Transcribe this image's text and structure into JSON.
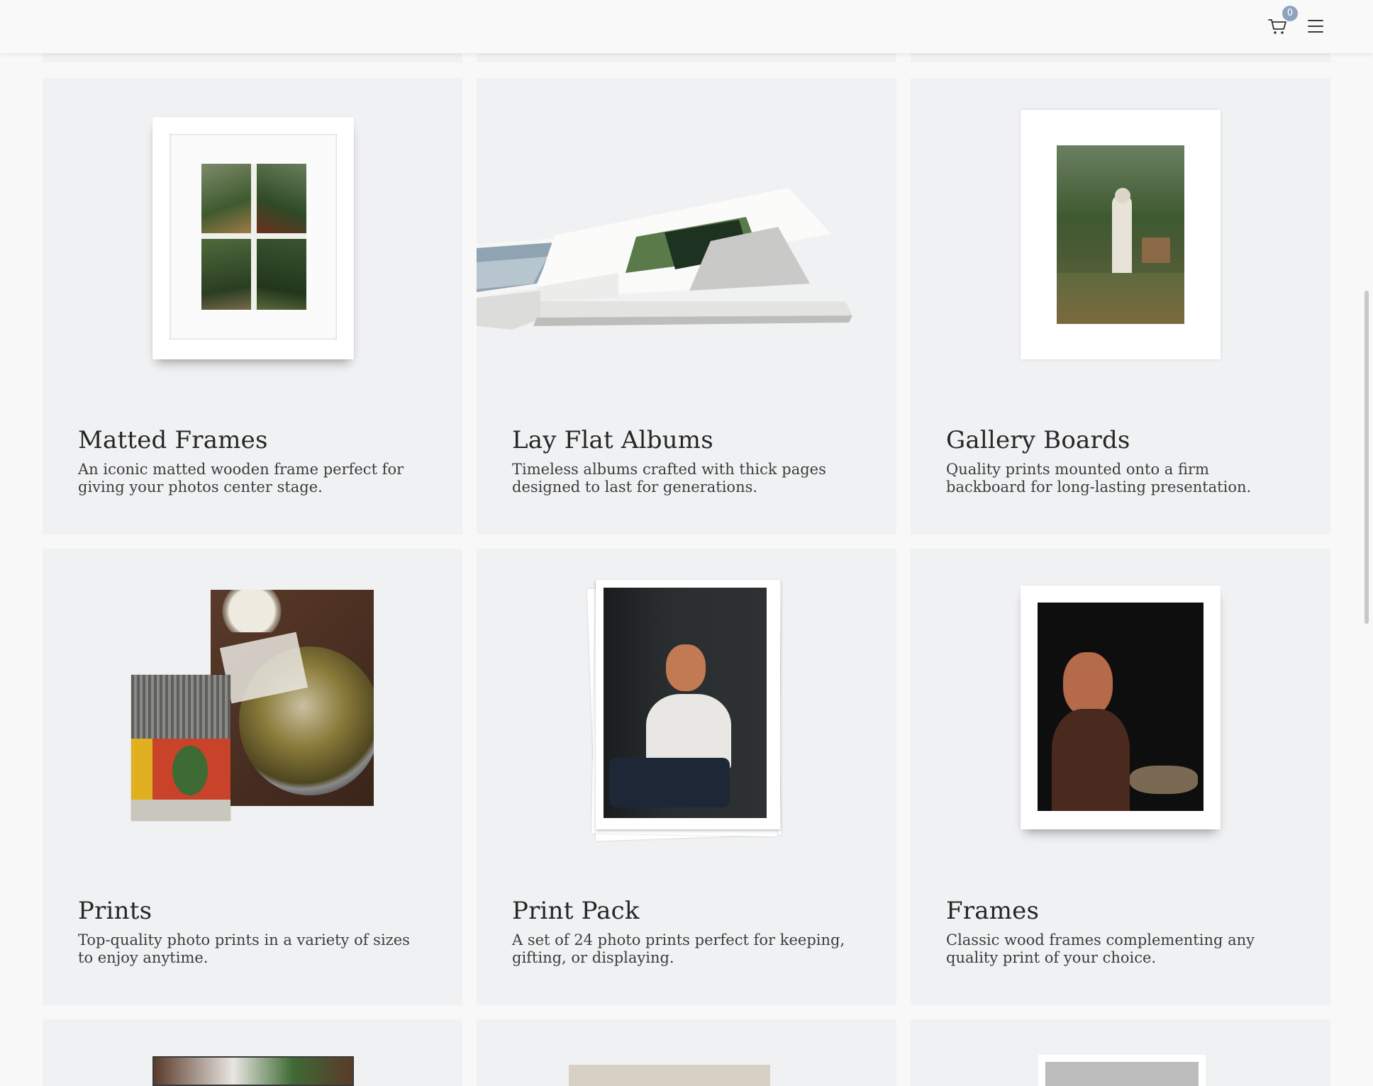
{
  "header": {
    "cart_icon": "cart-icon",
    "cart_count": "0",
    "menu_icon": "hamburger-menu-icon"
  },
  "products": [
    {
      "title": "Matted Frames",
      "description": "An iconic matted wooden frame perfect for giving your photos center stage."
    },
    {
      "title": "Lay Flat Albums",
      "description": "Timeless albums crafted with thick pages designed to last for generations."
    },
    {
      "title": "Gallery Boards",
      "description": "Quality prints mounted onto a firm backboard for long-lasting presentation."
    },
    {
      "title": "Prints",
      "description": "Top-quality photo prints in a variety of sizes to enjoy anytime."
    },
    {
      "title": "Print Pack",
      "description": "A set of 24 photo prints perfect for keeping, gifting, or displaying."
    },
    {
      "title": "Frames",
      "description": "Classic wood frames complementing any quality print of your choice."
    }
  ],
  "colors": {
    "card_bg": "#f0f1f2",
    "badge": "#8ea4bd",
    "page_bg": "#f8f8f8"
  }
}
